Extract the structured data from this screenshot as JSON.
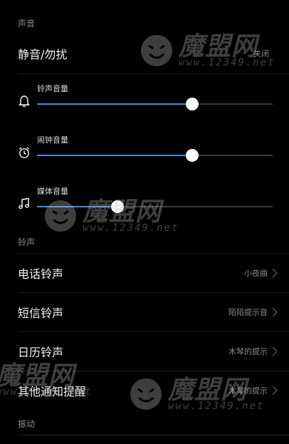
{
  "sections": {
    "sound": "声音",
    "ringtone": "铃声",
    "vibrate": "振动"
  },
  "mute": {
    "title": "静音/勿扰",
    "value": "关闭"
  },
  "sliders": [
    {
      "icon": "bell-icon",
      "label": "铃声音量",
      "level": 0.66
    },
    {
      "icon": "alarm-clock-icon",
      "label": "闹钟音量",
      "level": 0.66
    },
    {
      "icon": "music-note-icon",
      "label": "媒体音量",
      "level": 0.34
    }
  ],
  "ringtones": [
    {
      "title": "电话铃声",
      "value": "小夜曲"
    },
    {
      "title": "短信铃声",
      "value": "陌陌提示音"
    },
    {
      "title": "日历铃声",
      "value": "木琴的提示"
    },
    {
      "title": "其他通知提醒",
      "value": "木琴的提示"
    }
  ],
  "watermark": {
    "brand": "魔盟网",
    "url": "www.12349.net"
  },
  "colors": {
    "background": "#000000",
    "accent": "#3b8fd9",
    "secondary_text": "#8a8a8a"
  }
}
